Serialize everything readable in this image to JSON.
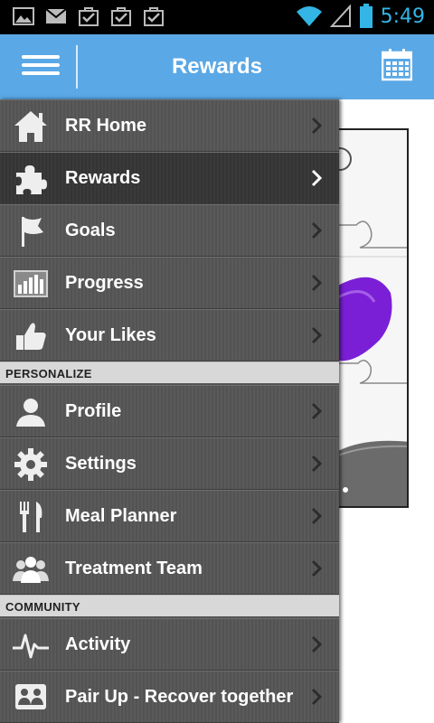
{
  "status_bar": {
    "time": "5:49",
    "left_icons": [
      "image-icon",
      "gmail-icon",
      "checkbox-bag-icon",
      "checkbox-bag-icon",
      "checkbox-bag-icon"
    ],
    "right_icons": [
      "wifi-icon",
      "signal-icon",
      "battery-icon"
    ],
    "accent": "#33b5e5"
  },
  "app_bar": {
    "title": "Rewards",
    "color": "#5aa8e6",
    "left_icon": "hamburger-icon",
    "right_icon": "calendar-icon"
  },
  "drawer": {
    "main_items": [
      {
        "label": "RR Home",
        "icon": "home-icon"
      },
      {
        "label": "Rewards",
        "icon": "puzzle-icon",
        "active": true
      },
      {
        "label": "Goals",
        "icon": "flag-icon"
      },
      {
        "label": "Progress",
        "icon": "bar-chart-icon"
      },
      {
        "label": "Your Likes",
        "icon": "thumbs-up-icon"
      }
    ],
    "personalize_header": "PERSONALIZE",
    "personalize_items": [
      {
        "label": "Profile",
        "icon": "person-icon"
      },
      {
        "label": "Settings",
        "icon": "gear-icon"
      },
      {
        "label": "Meal Planner",
        "icon": "fork-knife-icon"
      },
      {
        "label": "Treatment Team",
        "icon": "group-icon"
      }
    ],
    "community_header": "COMMUNITY",
    "community_items": [
      {
        "label": "Activity",
        "icon": "pulse-icon"
      },
      {
        "label": "Pair Up - Recover together",
        "icon": "pair-icon"
      }
    ]
  }
}
